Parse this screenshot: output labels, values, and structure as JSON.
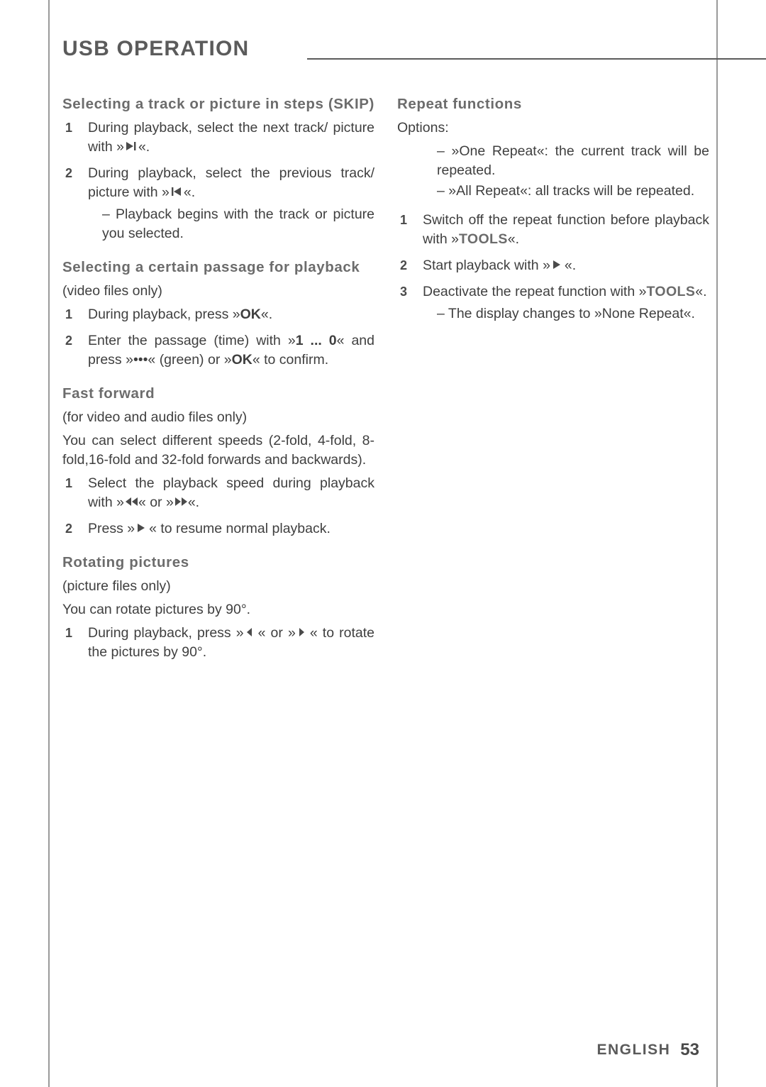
{
  "header": {
    "title": "USB OPERATION"
  },
  "left_column": {
    "sections": [
      {
        "heading": "Selecting a track or picture in steps (SKIP)",
        "steps": [
          {
            "num": "1",
            "text_before": "During playback, select the next track/ picture with »",
            "icon": "skip-next-icon",
            "text_after": "«."
          },
          {
            "num": "2",
            "text_before": "During playback, select the previous track/ picture with »",
            "icon": "skip-previous-icon",
            "text_after": "«.",
            "sub": "– Playback begins with the track or picture you selected."
          }
        ]
      },
      {
        "heading": "Selecting a certain passage for playback",
        "note": "(video files only)",
        "steps": [
          {
            "num": "1",
            "text_before": "During playback, press »",
            "bold": "OK",
            "text_after": "«."
          },
          {
            "num": "2",
            "text_before": "Enter the passage (time) with »",
            "bold": "1 ... 0",
            "text_after": "« and press »•••« (green) or »",
            "bold2": "OK",
            "text_after2": "« to confirm."
          }
        ]
      },
      {
        "heading": "Fast forward",
        "note": "(for video and audio files only)",
        "paragraph": "You can select different speeds (2-fold, 4-fold, 8-fold,16-fold and 32-fold forwards and backwards).",
        "steps": [
          {
            "num": "1",
            "text_before": "Select the playback speed during playback with »",
            "icon1": "rewind-icon",
            "text_mid": "« or »",
            "icon2": "fast-forward-icon",
            "text_after": "«."
          },
          {
            "num": "2",
            "text_before": "Press »",
            "icon": "play-icon",
            "text_after": "« to resume normal playback."
          }
        ]
      },
      {
        "heading": "Rotating pictures",
        "note": "(picture files only)",
        "paragraph": "You can rotate pictures by 90°.",
        "steps": [
          {
            "num": "1",
            "text_before": "During playback, press »",
            "icon1": "arrow-left-icon",
            "text_mid": "« or »",
            "icon2": "arrow-right-icon",
            "text_after": "« to rotate the pictures by 90°."
          }
        ]
      }
    ]
  },
  "right_column": {
    "sections": [
      {
        "heading": "Repeat functions",
        "note": "Options:",
        "options": [
          "– »One Repeat«: the current track will be repeated.",
          "– »All Repeat«: all tracks will be repeated."
        ],
        "steps": [
          {
            "num": "1",
            "text_before": "Switch off the repeat function before playback with »",
            "bold": "TOOLS",
            "text_after": "«."
          },
          {
            "num": "2",
            "text_before": "Start playback with »",
            "icon": "play-icon",
            "text_after": "«."
          },
          {
            "num": "3",
            "text_before": "Deactivate the repeat function with »",
            "bold": "TOOLS",
            "text_after": "«.",
            "sub": "– The display changes to »None Repeat«."
          }
        ]
      }
    ]
  },
  "footer": {
    "language": "ENGLISH",
    "page_number": "53"
  }
}
